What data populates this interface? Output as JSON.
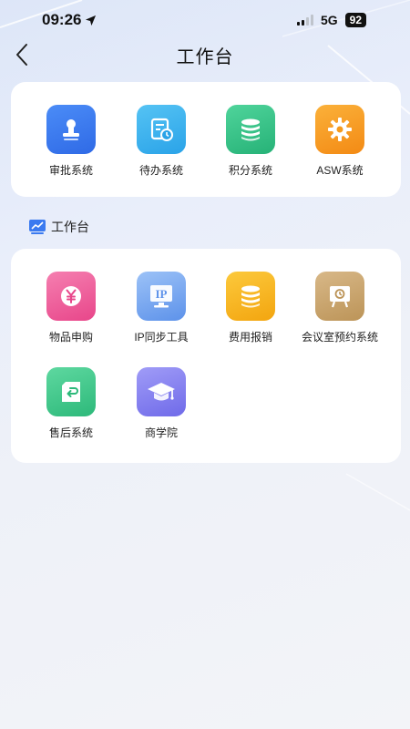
{
  "status_bar": {
    "time": "09:26",
    "network": "5G",
    "battery": "92"
  },
  "nav": {
    "title": "工作台"
  },
  "top_apps": [
    {
      "label": "审批系统",
      "icon": "stamp-icon",
      "color": "#3a7af0"
    },
    {
      "label": "待办系统",
      "icon": "todo-clock-icon",
      "color": "#3cb2ee"
    },
    {
      "label": "积分系统",
      "icon": "database-stack-icon",
      "color": "#34c48a"
    },
    {
      "label": "ASW系统",
      "icon": "gear-icon",
      "color": "#f7a024"
    }
  ],
  "section": {
    "title": "工作台",
    "icon": "line-chart-icon"
  },
  "workbench_apps": [
    {
      "label": "物品申购",
      "icon": "yen-icon",
      "color": "#ef5f9c"
    },
    {
      "label": "IP同步工具",
      "icon": "ip-monitor-icon",
      "color": "#78a9f2"
    },
    {
      "label": "费用报销",
      "icon": "coin-stack-icon",
      "color": "#f6b622"
    },
    {
      "label": "会议室预约系统",
      "icon": "meeting-board-icon",
      "color": "#c9a46c"
    },
    {
      "label": "售后系统",
      "icon": "return-box-icon",
      "color": "#3ec68b"
    },
    {
      "label": "商学院",
      "icon": "graduation-cap-icon",
      "color": "#8a86f2"
    }
  ]
}
